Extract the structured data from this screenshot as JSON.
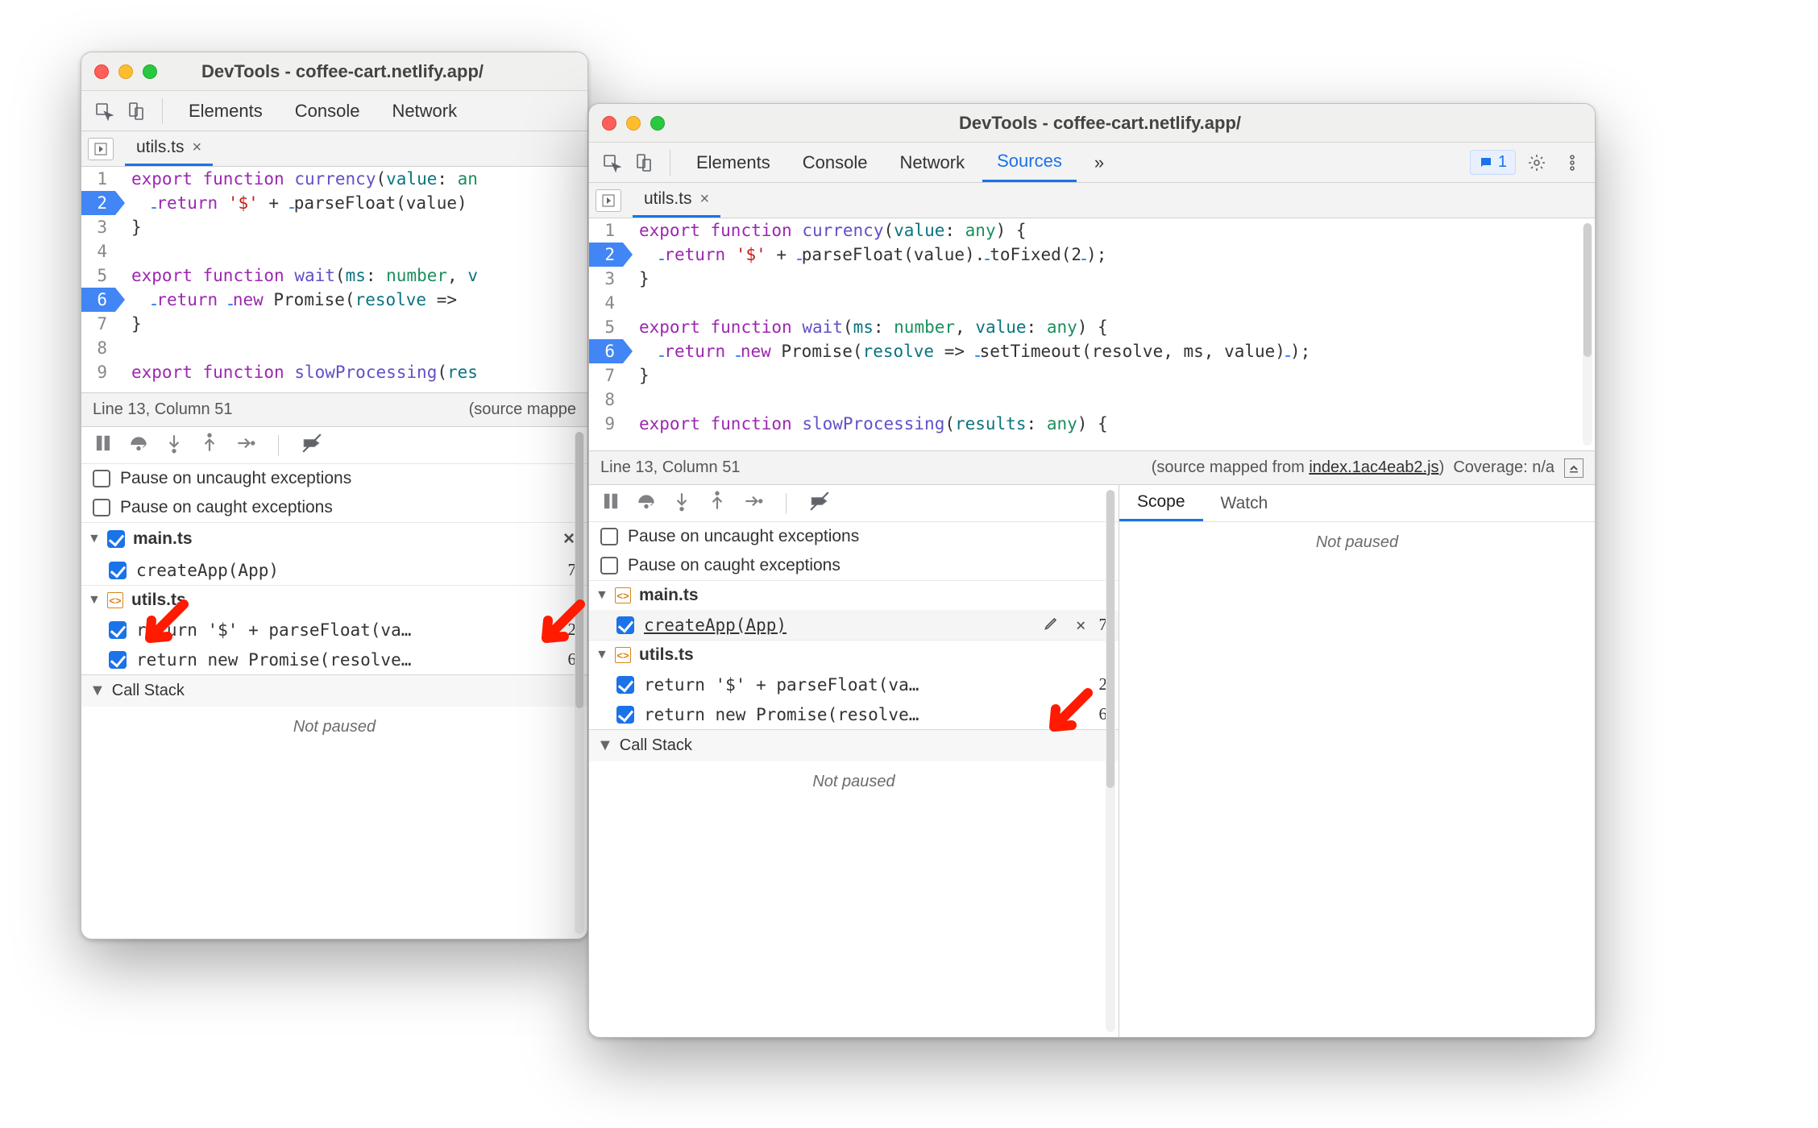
{
  "title": "DevTools - coffee-cart.netlify.app/",
  "tabs": {
    "elements": "Elements",
    "console": "Console",
    "network": "Network",
    "sources": "Sources",
    "more": "»",
    "issues_count": "1"
  },
  "file_tab": "utils.ts",
  "code": {
    "l1": "export function currency(value: any) {",
    "l2": "  return '$' + parseFloat(value).toFixed(2);",
    "l3": "}",
    "l4": "",
    "l5": "export function wait(ms: number, value: any) {",
    "l6": "  return new Promise(resolve => setTimeout(resolve, ms, value));",
    "l7": "}",
    "l8": "",
    "l9": "export function slowProcessing(results: any) {",
    "line_numbers": [
      "1",
      "2",
      "3",
      "4",
      "5",
      "6",
      "7",
      "8",
      "9"
    ],
    "bp_lines": [
      2,
      6
    ]
  },
  "status": {
    "pos": "Line 13, Column 51",
    "mapped_prefix": "(source mapped from ",
    "mapped_file": "index.1ac4eab2.js",
    "mapped_suffix": ")",
    "coverage": "Coverage: n/a",
    "mapped_truncated": "(source mappe"
  },
  "debugger": {
    "pause_uncaught": "Pause on uncaught exceptions",
    "pause_caught": "Pause on caught exceptions",
    "groups": [
      {
        "file": "main.ts",
        "checked_header": true,
        "items": [
          {
            "label": "createApp(App)",
            "line": "7",
            "editable": true
          }
        ]
      },
      {
        "file": "utils.ts",
        "checked_header": false,
        "items": [
          {
            "label": "return '$' + parseFloat(va…",
            "line": "2"
          },
          {
            "label": "return new Promise(resolve…",
            "line": "6"
          }
        ]
      }
    ],
    "call_stack": "Call Stack",
    "not_paused": "Not paused"
  },
  "right": {
    "scope": "Scope",
    "watch": "Watch",
    "not_paused": "Not paused"
  }
}
